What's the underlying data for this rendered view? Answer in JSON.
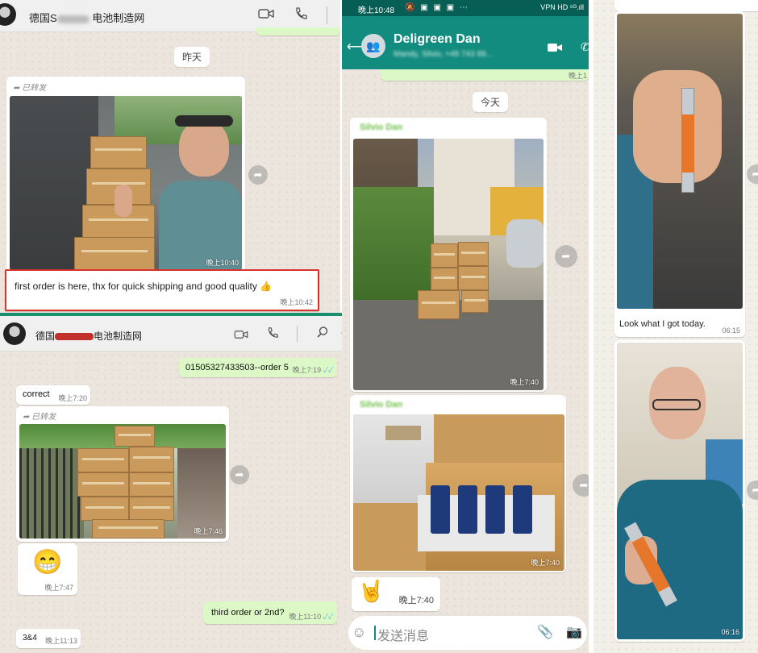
{
  "left_top": {
    "title_prefix": "德国S",
    "title_blurred": "chmidt",
    "title_suffix": " 电池制造网",
    "date_chip": "昨天",
    "forwarded_label": "已转发",
    "photo_time": "晚上10:40",
    "message_text": "first order is here, thx for quick shipping and good quality",
    "message_emoji": "👍",
    "message_time": "晚上10:42"
  },
  "left_bottom": {
    "title_prefix": "德国",
    "title_suffix": "电池制造网",
    "out_message_1": "01505327433503--order 5",
    "out_message_1_time": "晚上7:19",
    "in_message_1": "correct",
    "in_message_1_time": "晚上7:20",
    "forwarded_label": "已转发",
    "photo_time": "晚上7:46",
    "emoji": "😁",
    "emoji_time": "晚上7:47",
    "out_message_2": "third order or 2nd?",
    "out_message_2_time": "晚上11:10",
    "in_message_2": "3&4",
    "in_message_2_time": "晚上11:13"
  },
  "middle": {
    "status_time": "晚上10:48",
    "status_icons": "VPN HD ⁵ᴳ.ıll",
    "contact_name": "Deligreen Dan",
    "contact_sub": "Mandy, Silvio, +49 743 89...",
    "top_time": "晚上1",
    "date_chip": "今天",
    "sender_1": "Silvio Dan",
    "photo_1_time": "晚上7:40",
    "sender_2": "Silvio Dan",
    "photo_2_time": "晚上7:40",
    "emoji": "🤘",
    "emoji_time": "晚上7:40",
    "input_placeholder": "发送消息"
  },
  "right": {
    "caption": "Look what I got today.",
    "caption_time": "06:15",
    "video_time": "06:16"
  },
  "colors": {
    "whatsapp_green": "#128c7e",
    "status_green": "#075e54",
    "highlight_red": "#d9312b",
    "divider_green": "#1a8f6d"
  }
}
